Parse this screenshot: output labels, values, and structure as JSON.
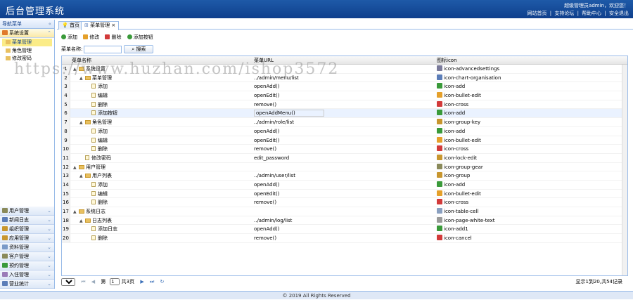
{
  "header": {
    "title": "后台管理系统",
    "welcome": "超级管理员admin，欢迎您！",
    "links": [
      "网站首页",
      "|",
      "支持论坛",
      "|",
      "帮助中心",
      "|",
      "安全退出"
    ]
  },
  "sidebar": {
    "title": "导航菜单",
    "open_section": "系统设置",
    "items": [
      {
        "label": "菜单管理",
        "selected": true
      },
      {
        "label": "角色管理",
        "selected": false
      },
      {
        "label": "修改密码",
        "selected": false
      }
    ],
    "sections": [
      "用户管理",
      "新闻日志",
      "组织管理",
      "应用管理",
      "资料管理",
      "客户管理",
      "预约管理",
      "入住管理",
      "营业统计"
    ]
  },
  "tabs": [
    {
      "label": "首页",
      "icon": "lightbulb-icon"
    },
    {
      "label": "菜单管理",
      "icon": "sitemap-icon"
    }
  ],
  "toolbar": {
    "add": "添加",
    "edit": "修改",
    "delete": "删除",
    "add_menu": "添加按钮"
  },
  "search": {
    "label": "菜单名称:",
    "button": "搜索"
  },
  "grid": {
    "columns": [
      "菜单名称",
      "菜单URL",
      "图标icon"
    ],
    "rows": [
      {
        "n": "1",
        "indent": 0,
        "tri": "▲",
        "kind": "folder",
        "name": "系统设置",
        "url": "",
        "icon": "icon-advancedsettings",
        "color": "#7a7a9a"
      },
      {
        "n": "2",
        "indent": 1,
        "tri": "▲",
        "kind": "folder",
        "name": "菜单管理",
        "url": "../admin/menu/list",
        "icon": "icon-chart-organisation",
        "color": "#5b7db8"
      },
      {
        "n": "3",
        "indent": 2,
        "tri": "",
        "kind": "file",
        "name": "添加",
        "url": "openAdd()",
        "icon": "icon-add",
        "color": "#3a9a3a"
      },
      {
        "n": "4",
        "indent": 2,
        "tri": "",
        "kind": "file",
        "name": "编辑",
        "url": "openEdit()",
        "icon": "icon-bullet-edit",
        "color": "#e5a02a"
      },
      {
        "n": "5",
        "indent": 2,
        "tri": "",
        "kind": "file",
        "name": "删除",
        "url": "remove()",
        "icon": "icon-cross",
        "color": "#d23a3a"
      },
      {
        "n": "6",
        "indent": 2,
        "tri": "",
        "kind": "file",
        "name": "添加按钮",
        "url": "openAddMenu()",
        "icon": "icon-add",
        "color": "#3a9a3a",
        "hl": true
      },
      {
        "n": "7",
        "indent": 1,
        "tri": "▲",
        "kind": "folder",
        "name": "角色管理",
        "url": "../admin/role/list",
        "icon": "icon-group-key",
        "color": "#c8962e"
      },
      {
        "n": "8",
        "indent": 2,
        "tri": "",
        "kind": "file",
        "name": "添加",
        "url": "openAdd()",
        "icon": "icon-add",
        "color": "#3a9a3a"
      },
      {
        "n": "9",
        "indent": 2,
        "tri": "",
        "kind": "file",
        "name": "编辑",
        "url": "openEdit()",
        "icon": "icon-bullet-edit",
        "color": "#e5a02a"
      },
      {
        "n": "10",
        "indent": 2,
        "tri": "",
        "kind": "file",
        "name": "删除",
        "url": "remove()",
        "icon": "icon-cross",
        "color": "#d23a3a"
      },
      {
        "n": "11",
        "indent": 1,
        "tri": "",
        "kind": "file",
        "name": "修改密码",
        "url": "edit_password",
        "icon": "icon-lock-edit",
        "color": "#c8962e"
      },
      {
        "n": "12",
        "indent": 0,
        "tri": "▲",
        "kind": "folder",
        "name": "用户管理",
        "url": "",
        "icon": "icon-group-gear",
        "color": "#8a8a5a"
      },
      {
        "n": "13",
        "indent": 1,
        "tri": "▲",
        "kind": "folder",
        "name": "用户列表",
        "url": "../admin/user/list",
        "icon": "icon-group",
        "color": "#c8962e"
      },
      {
        "n": "14",
        "indent": 2,
        "tri": "",
        "kind": "file",
        "name": "添加",
        "url": "openAdd()",
        "icon": "icon-add",
        "color": "#3a9a3a"
      },
      {
        "n": "15",
        "indent": 2,
        "tri": "",
        "kind": "file",
        "name": "编辑",
        "url": "openEdit()",
        "icon": "icon-bullet-edit",
        "color": "#e5a02a"
      },
      {
        "n": "16",
        "indent": 2,
        "tri": "",
        "kind": "file",
        "name": "删除",
        "url": "remove()",
        "icon": "icon-cross",
        "color": "#d23a3a"
      },
      {
        "n": "17",
        "indent": 0,
        "tri": "▲",
        "kind": "folder",
        "name": "系统日志",
        "url": "",
        "icon": "icon-table-cell",
        "color": "#8aa0c0"
      },
      {
        "n": "18",
        "indent": 1,
        "tri": "▲",
        "kind": "folder",
        "name": "日志列表",
        "url": "../admin/log/list",
        "icon": "icon-page-white-text",
        "color": "#9a9a9a"
      },
      {
        "n": "19",
        "indent": 2,
        "tri": "",
        "kind": "file",
        "name": "添加日志",
        "url": "openAdd()",
        "icon": "icon-add1",
        "color": "#3a9a3a"
      },
      {
        "n": "20",
        "indent": 2,
        "tri": "",
        "kind": "file",
        "name": "删除",
        "url": "remove()",
        "icon": "icon-cancel",
        "color": "#d23a3a"
      }
    ]
  },
  "pager": {
    "page_size": "20",
    "page_label": "第",
    "page_value": "1",
    "total_pages": "共3页",
    "info": "显示1到20,共54记录"
  },
  "footer": "© 2019 All Rights Reserved",
  "watermark": "https://www.huzhan.com/ishop3572"
}
